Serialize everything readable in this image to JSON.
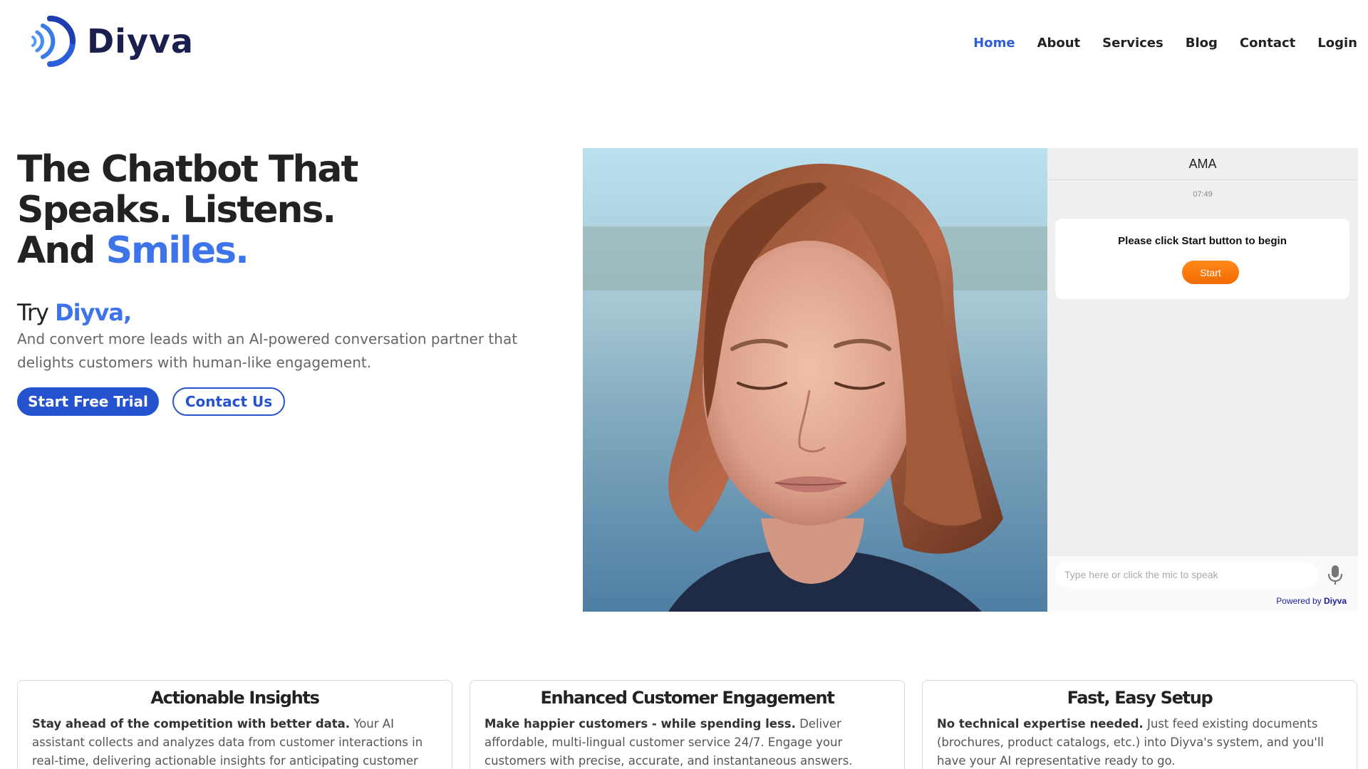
{
  "brand": {
    "name": "Diyva"
  },
  "nav": {
    "items": [
      {
        "label": "Home",
        "active": true
      },
      {
        "label": "About"
      },
      {
        "label": "Services"
      },
      {
        "label": "Blog"
      },
      {
        "label": "Contact"
      },
      {
        "label": "Login"
      }
    ]
  },
  "hero": {
    "line1": "The Chatbot That",
    "line2": "Speaks. Listens.",
    "line3_prefix": "And ",
    "line3_accent": "Smiles.",
    "try_prefix": "Try ",
    "try_accent": "Diyva,",
    "subtitle": "And convert more leads with an AI-powered conversation partner that delights customers with human-like engagement.",
    "primary_button": "Start Free Trial",
    "secondary_button": "Contact Us"
  },
  "chat": {
    "title": "AMA",
    "time": "07:49",
    "prompt": "Please click Start button to begin",
    "start_label": "Start",
    "input_placeholder": "Type here or click the mic to speak",
    "powered_prefix": "Powered by ",
    "powered_brand": "Diyva"
  },
  "features": [
    {
      "title": "Actionable Insights",
      "lead": "Stay ahead of the competition with better data.",
      "text": " Your AI assistant collects and analyzes data from customer interactions in real-time, delivering actionable insights for anticipating customer needs and"
    },
    {
      "title": "Enhanced Customer Engagement",
      "lead": "Make happier customers - while spending less.",
      "text": " Deliver affordable, multi-lingual customer service 24/7. Engage your customers with precise, accurate, and instantaneous answers."
    },
    {
      "title": "Fast, Easy Setup",
      "lead": "No technical expertise needed.",
      "text": " Just feed existing documents (brochures, product catalogs, etc.) into Diyva's system, and you'll have your AI representative ready to go."
    }
  ],
  "colors": {
    "accent": "#3d74ea",
    "primary_button": "#2553d0",
    "start_button": "#f57a0c",
    "logo_dark": "#1b1f4d"
  }
}
